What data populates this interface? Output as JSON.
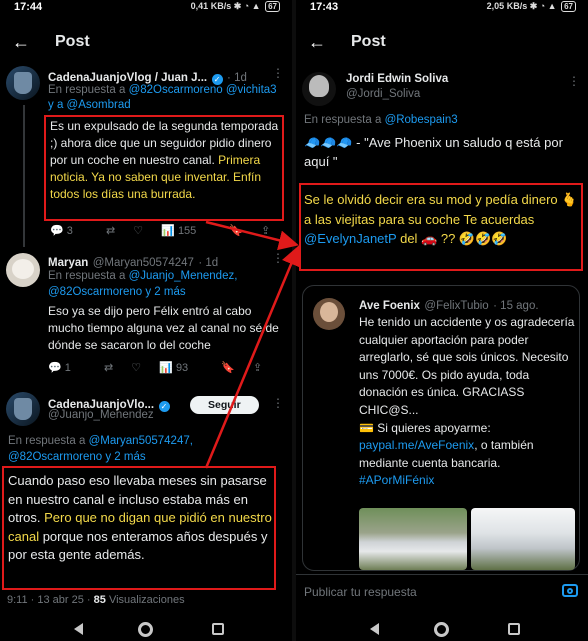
{
  "left": {
    "status": {
      "time": "17:44",
      "net": "0,41 KB/s",
      "battery": "67"
    },
    "header": {
      "title": "Post"
    },
    "posts": [
      {
        "name": "CadenaJuanjoVlog / Juan J...",
        "time": "1d",
        "reply_prefix": "En respuesta a",
        "mentions": "@82Oscarmoreno @vichita3",
        "mentions2": "y a @Asombrad",
        "text_a": "Es un expulsado de la segunda temporada ;) ahora dice que un seguidor pidio dinero por un coche en nuestro canal.",
        "text_b": "Primera noticia. Ya no saben que inventar. Enfín todos los días una burrada.",
        "actions": {
          "replies": "3",
          "views": "155"
        }
      },
      {
        "name": "Maryan",
        "handle": "@Maryan50574247",
        "time": "1d",
        "reply_prefix": "En respuesta a",
        "mentions": "@Juanjo_Menendez,",
        "mentions2": "@82Oscarmoreno y 2 más",
        "text": "Eso ya se dijo pero Félix entró al cabo mucho tiempo alguna vez al canal no sé de dónde se sacaron lo del coche",
        "actions": {
          "replies": "1",
          "views": "93"
        }
      },
      {
        "name": "CadenaJuanjoVlo...",
        "handle": "@Juanjo_Menendez",
        "follow": "Seguir",
        "reply_prefix": "En respuesta a",
        "mentions": "@Maryan50574247,",
        "mentions2": "@82Oscarmoreno y 2 más",
        "text_a": "Cuando paso eso llevaba meses sin pasarse en nuestro canal e incluso estaba más en otros.",
        "text_b": "Pero que no digan que pidió en nuestro canal",
        "text_c": "porque nos enteramos años después y por esta gente además.",
        "meta_time": "9:11 · 13 abr 25 ·",
        "meta_views": "85",
        "meta_views_label": "Visualizaciones"
      }
    ]
  },
  "right": {
    "status": {
      "time": "17:43",
      "net": "2,05 KB/s",
      "battery": "67"
    },
    "header": {
      "title": "Post"
    },
    "post": {
      "name": "Jordi Edwin Soliva",
      "handle": "@Jordi_Soliva",
      "reply_prefix": "En respuesta a",
      "mention": "@Robespain3",
      "text1": "🧢🧢🧢 - \"Ave Phoenix un saludo q está por aquí \"",
      "text2_a": "Se le olvidó decir era su mod y pedía dinero 🫰 a las viejitas para su coche Te acuerdas",
      "text2_link": "@EvelynJanetP",
      "text2_b": "del 🚗 ?? 🤣🤣🤣"
    },
    "quote": {
      "name": "Ave Foenix",
      "handle": "@FelixTubio",
      "time": "15 ago.",
      "text": "He tenido un accidente y os agradecería cualquier aportación para poder arreglarlo, sé que sois únicos. Necesito uns 7000€. Os pido ayuda, toda donación es única. GRACIASS CHIC@S...",
      "support": "💳 Si quieres apoyarme:",
      "link": "paypal.me/AveFoenix",
      "after_link": ", o también mediante cuenta bancaria.",
      "hashtag": "#APorMiFénix"
    },
    "composer": {
      "placeholder": "Publicar tu respuesta"
    }
  },
  "colors": {
    "highlight": "#f3d94a",
    "box": "#e01a1a",
    "link": "#1d9bf0"
  }
}
